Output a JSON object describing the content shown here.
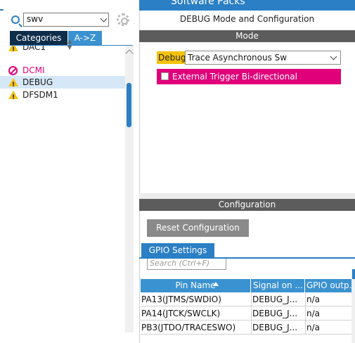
{
  "top_banner": {
    "label": "Software Packs"
  },
  "left": {
    "search": {
      "value": "swv"
    },
    "tabs": [
      {
        "label": "Categories"
      },
      {
        "label": "A->Z"
      }
    ],
    "items": [
      {
        "label": "DAC1",
        "icon": "warning-icon"
      },
      {
        "label": "DCMI",
        "icon": "block-icon"
      },
      {
        "label": "DEBUG",
        "icon": "warning-icon",
        "selected": true
      },
      {
        "label": "DFSDM1",
        "icon": "warning-icon"
      }
    ]
  },
  "right": {
    "title": "DEBUG Mode and Configuration",
    "mode_header": "Mode",
    "debug_label": "Debug",
    "debug_value": "Trace Asynchronous Sw",
    "ext_trigger_label": "External Trigger Bi-directional",
    "config_header": "Configuration",
    "reset_button": "Reset Configuration",
    "gpio_tab": "GPIO Settings",
    "gpio_search_placeholder": "Search (Ctrl+F)",
    "table": {
      "headers": [
        "Pin Name",
        "Signal on ...",
        "GPIO outp..."
      ],
      "rows": [
        [
          "PA13(JTMS/SWDIO)",
          "DEBUG_J...",
          "n/a"
        ],
        [
          "PA14(JTCK/SWCLK)",
          "DEBUG_J...",
          "n/a"
        ],
        [
          "PB3(JTDO/TRACESWO)",
          "DEBUG_J...",
          "n/a"
        ]
      ]
    }
  },
  "colors": {
    "accent": "#2b7fc4",
    "warning": "#f4c20d",
    "error": "#e0007a",
    "header_gray": "#5c5c5c"
  }
}
